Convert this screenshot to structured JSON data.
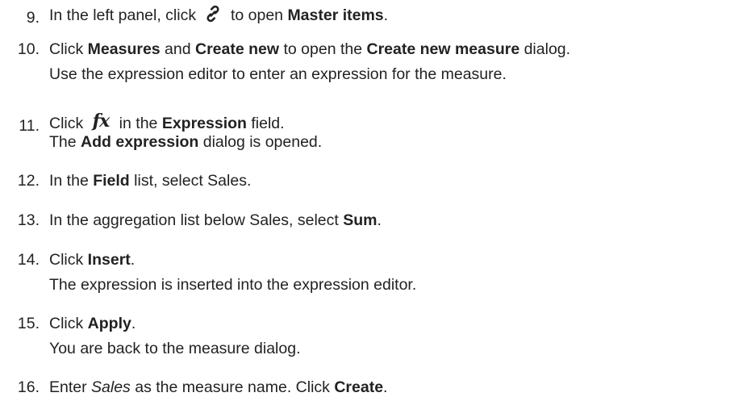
{
  "steps": [
    {
      "num": "9.",
      "parts": [
        {
          "t": "In the left panel, click "
        },
        {
          "icon": "link-icon"
        },
        {
          "t": " to open "
        },
        {
          "b": "Master items"
        },
        {
          "t": "."
        }
      ]
    },
    {
      "num": "10.",
      "parts": [
        {
          "t": "Click "
        },
        {
          "b": "Measures"
        },
        {
          "t": " and "
        },
        {
          "b": "Create new"
        },
        {
          "t": " to open the "
        },
        {
          "b": "Create new measure"
        },
        {
          "t": " dialog."
        }
      ],
      "sub": "Use the expression editor to enter an expression for the measure."
    },
    {
      "num": "11.",
      "parts": [
        {
          "t": "Click "
        },
        {
          "icon": "fx-icon",
          "glyph": "fx"
        },
        {
          "t": " in the "
        },
        {
          "b": "Expression"
        },
        {
          "t": " field."
        }
      ],
      "sub_parts": [
        {
          "t": "The "
        },
        {
          "b": "Add expression"
        },
        {
          "t": " dialog is opened."
        }
      ]
    },
    {
      "num": "12.",
      "parts": [
        {
          "t": "In the "
        },
        {
          "b": "Field"
        },
        {
          "t": " list, select Sales."
        }
      ]
    },
    {
      "num": "13.",
      "parts": [
        {
          "t": "In the aggregation list below Sales, select "
        },
        {
          "b": "Sum"
        },
        {
          "t": "."
        }
      ]
    },
    {
      "num": "14.",
      "parts": [
        {
          "t": "Click "
        },
        {
          "b": "Insert"
        },
        {
          "t": "."
        }
      ],
      "sub": "The expression is inserted into the expression editor."
    },
    {
      "num": "15.",
      "parts": [
        {
          "t": "Click "
        },
        {
          "b": "Apply"
        },
        {
          "t": "."
        }
      ],
      "sub": "You are back to the measure dialog."
    },
    {
      "num": "16.",
      "parts": [
        {
          "t": "Enter "
        },
        {
          "i": "Sales"
        },
        {
          "t": " as the measure name. Click "
        },
        {
          "b": "Create"
        },
        {
          "t": "."
        }
      ]
    }
  ]
}
